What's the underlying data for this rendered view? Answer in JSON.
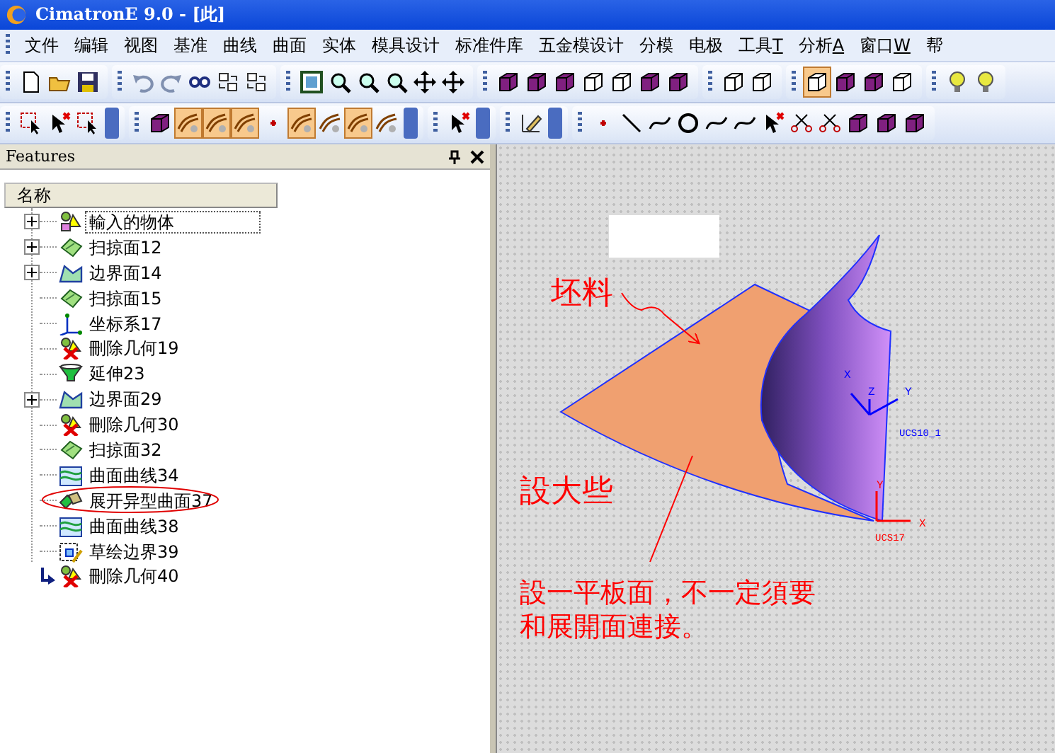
{
  "window": {
    "title": "CimatronE 9.0 - [此]"
  },
  "menu": [
    {
      "label": "文件"
    },
    {
      "label": "编辑"
    },
    {
      "label": "视图"
    },
    {
      "label": "基准"
    },
    {
      "label": "曲线"
    },
    {
      "label": "曲面"
    },
    {
      "label": "实体"
    },
    {
      "label": "模具设计"
    },
    {
      "label": "标准件库"
    },
    {
      "label": "五金模设计"
    },
    {
      "label": "分模"
    },
    {
      "label": "电极"
    },
    {
      "label": "工具",
      "accel": "T"
    },
    {
      "label": "分析",
      "accel": "A"
    },
    {
      "label": "窗口",
      "accel": "W"
    },
    {
      "label": "帮"
    }
  ],
  "toolbars": [
    {
      "groups": [
        [
          {
            "pressed": false
          },
          {
            "pressed": false
          },
          {
            "pressed": false
          }
        ],
        [
          {
            "pressed": false
          },
          {
            "pressed": false
          },
          {
            "pressed": false
          },
          {
            "pressed": false
          },
          {
            "pressed": false
          }
        ],
        [
          {
            "pressed": false
          },
          {
            "pressed": false
          },
          {
            "pressed": false
          },
          {
            "pressed": false
          },
          {
            "pressed": false
          },
          {
            "pressed": false
          }
        ],
        [
          {
            "pressed": false
          },
          {
            "pressed": false
          },
          {
            "pressed": false
          },
          {
            "pressed": false
          },
          {
            "pressed": false
          },
          {
            "pressed": false
          },
          {
            "pressed": false
          }
        ],
        [
          {
            "pressed": false
          },
          {
            "pressed": false
          }
        ],
        [
          {
            "pressed": true
          },
          {
            "pressed": false
          },
          {
            "pressed": false
          },
          {
            "pressed": false
          }
        ],
        [
          {
            "pressed": false
          },
          {
            "pressed": false
          }
        ]
      ]
    },
    {
      "groups": [
        [
          {
            "pressed": false
          },
          {
            "pressed": false
          },
          {
            "pressed": false
          }
        ],
        [
          {
            "pressed": false
          },
          {
            "pressed": true
          },
          {
            "pressed": true
          },
          {
            "pressed": true
          },
          {
            "pressed": false
          },
          {
            "pressed": true
          },
          {
            "pressed": false
          },
          {
            "pressed": true
          },
          {
            "pressed": false
          }
        ],
        [
          {
            "pressed": false
          }
        ],
        [
          {
            "pressed": false
          }
        ],
        [
          {
            "pressed": false
          },
          {
            "pressed": false
          },
          {
            "pressed": false
          },
          {
            "pressed": false
          },
          {
            "pressed": false
          },
          {
            "pressed": false
          },
          {
            "pressed": false
          },
          {
            "pressed": false
          },
          {
            "pressed": false
          },
          {
            "pressed": false
          },
          {
            "pressed": false
          },
          {
            "pressed": false
          }
        ]
      ]
    }
  ],
  "panel": {
    "title": "Features",
    "column": "名称",
    "items": [
      {
        "label": "輸入的物体",
        "kind": "import",
        "expandable": true,
        "focused": true,
        "circled": false,
        "current": false
      },
      {
        "label": "扫掠面12",
        "kind": "sweep",
        "expandable": true,
        "focused": false,
        "circled": false,
        "current": false
      },
      {
        "label": "边界面14",
        "kind": "boundary",
        "expandable": true,
        "focused": false,
        "circled": false,
        "current": false
      },
      {
        "label": "扫掠面15",
        "kind": "sweep",
        "expandable": false,
        "focused": false,
        "circled": false,
        "current": false
      },
      {
        "label": "坐标系17",
        "kind": "ucs",
        "expandable": false,
        "focused": false,
        "circled": false,
        "current": false
      },
      {
        "label": "刪除几何19",
        "kind": "delete",
        "expandable": false,
        "focused": false,
        "circled": false,
        "current": false
      },
      {
        "label": "延伸23",
        "kind": "extend",
        "expandable": false,
        "focused": false,
        "circled": false,
        "current": false
      },
      {
        "label": "边界面29",
        "kind": "boundary",
        "expandable": true,
        "focused": false,
        "circled": false,
        "current": false
      },
      {
        "label": "刪除几何30",
        "kind": "delete",
        "expandable": false,
        "focused": false,
        "circled": false,
        "current": false
      },
      {
        "label": "扫掠面32",
        "kind": "sweep",
        "expandable": false,
        "focused": false,
        "circled": false,
        "current": false
      },
      {
        "label": "曲面曲线34",
        "kind": "curve",
        "expandable": false,
        "focused": false,
        "circled": false,
        "current": false
      },
      {
        "label": "展开异型曲面37",
        "kind": "unfold",
        "expandable": false,
        "focused": false,
        "circled": true,
        "current": false
      },
      {
        "label": "曲面曲线38",
        "kind": "curve",
        "expandable": false,
        "focused": false,
        "circled": false,
        "current": false
      },
      {
        "label": "草绘边界39",
        "kind": "sketch",
        "expandable": false,
        "focused": false,
        "circled": false,
        "current": false
      },
      {
        "label": "刪除几何40",
        "kind": "delete",
        "expandable": false,
        "focused": false,
        "circled": false,
        "current": true
      }
    ]
  },
  "viewport": {
    "triads": [
      {
        "name": "UCS10_1",
        "axes": [
          "X",
          "Z",
          "Y"
        ],
        "color": "#0000ff"
      },
      {
        "name": "UCS17",
        "axes": [
          "Y",
          "X"
        ],
        "color": "#ff0000"
      }
    ],
    "annotations": [
      {
        "text": "坯料"
      },
      {
        "text": "設大些"
      },
      {
        "text": "設一平板面，不一定須要"
      },
      {
        "text": "和展開面連接。"
      }
    ]
  }
}
